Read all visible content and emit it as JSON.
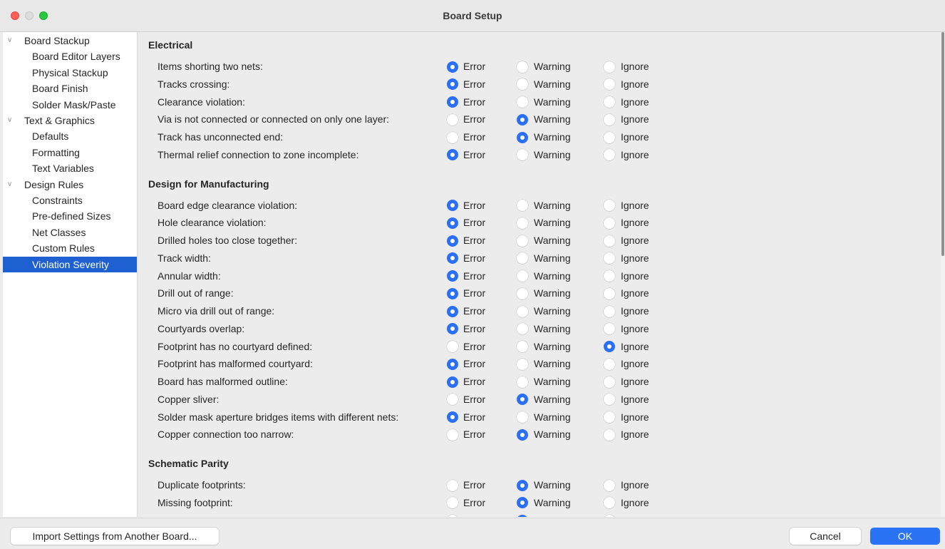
{
  "window": {
    "title": "Board Setup"
  },
  "sidebar": {
    "items": [
      {
        "label": "Board Stackup",
        "type": "parent"
      },
      {
        "label": "Board Editor Layers",
        "type": "child"
      },
      {
        "label": "Physical Stackup",
        "type": "child"
      },
      {
        "label": "Board Finish",
        "type": "child"
      },
      {
        "label": "Solder Mask/Paste",
        "type": "child"
      },
      {
        "label": "Text & Graphics",
        "type": "parent"
      },
      {
        "label": "Defaults",
        "type": "child"
      },
      {
        "label": "Formatting",
        "type": "child"
      },
      {
        "label": "Text Variables",
        "type": "child"
      },
      {
        "label": "Design Rules",
        "type": "parent"
      },
      {
        "label": "Constraints",
        "type": "child"
      },
      {
        "label": "Pre-defined Sizes",
        "type": "child"
      },
      {
        "label": "Net Classes",
        "type": "child"
      },
      {
        "label": "Custom Rules",
        "type": "child"
      },
      {
        "label": "Violation Severity",
        "type": "child",
        "selected": true
      }
    ]
  },
  "options": {
    "error": "Error",
    "warning": "Warning",
    "ignore": "Ignore"
  },
  "sections": [
    {
      "title": "Electrical",
      "rows": [
        {
          "label": "Items shorting two nets:",
          "value": "error"
        },
        {
          "label": "Tracks crossing:",
          "value": "error"
        },
        {
          "label": "Clearance violation:",
          "value": "error"
        },
        {
          "label": "Via is not connected or connected on only one layer:",
          "value": "warning"
        },
        {
          "label": "Track has unconnected end:",
          "value": "warning"
        },
        {
          "label": "Thermal relief connection to zone incomplete:",
          "value": "error"
        }
      ]
    },
    {
      "title": "Design for Manufacturing",
      "rows": [
        {
          "label": "Board edge clearance violation:",
          "value": "error"
        },
        {
          "label": "Hole clearance violation:",
          "value": "error"
        },
        {
          "label": "Drilled holes too close together:",
          "value": "error"
        },
        {
          "label": "Track width:",
          "value": "error"
        },
        {
          "label": "Annular width:",
          "value": "error"
        },
        {
          "label": "Drill out of range:",
          "value": "error"
        },
        {
          "label": "Micro via drill out of range:",
          "value": "error"
        },
        {
          "label": "Courtyards overlap:",
          "value": "error"
        },
        {
          "label": "Footprint has no courtyard defined:",
          "value": "ignore"
        },
        {
          "label": "Footprint has malformed courtyard:",
          "value": "error"
        },
        {
          "label": "Board has malformed outline:",
          "value": "error"
        },
        {
          "label": "Copper sliver:",
          "value": "warning"
        },
        {
          "label": "Solder mask aperture bridges items with different nets:",
          "value": "error"
        },
        {
          "label": "Copper connection too narrow:",
          "value": "warning"
        }
      ]
    },
    {
      "title": "Schematic Parity",
      "rows": [
        {
          "label": "Duplicate footprints:",
          "value": "warning"
        },
        {
          "label": "Missing footprint:",
          "value": "warning"
        },
        {
          "label": "Extra footprint:",
          "value": "warning"
        }
      ]
    }
  ],
  "footer": {
    "import_label": "Import Settings from Another Board...",
    "cancel_label": "Cancel",
    "ok_label": "OK"
  },
  "colors": {
    "accent": "#2a6ff5",
    "selection": "#1e5fd2",
    "close": "#ff5f57",
    "maximize": "#28c840"
  }
}
